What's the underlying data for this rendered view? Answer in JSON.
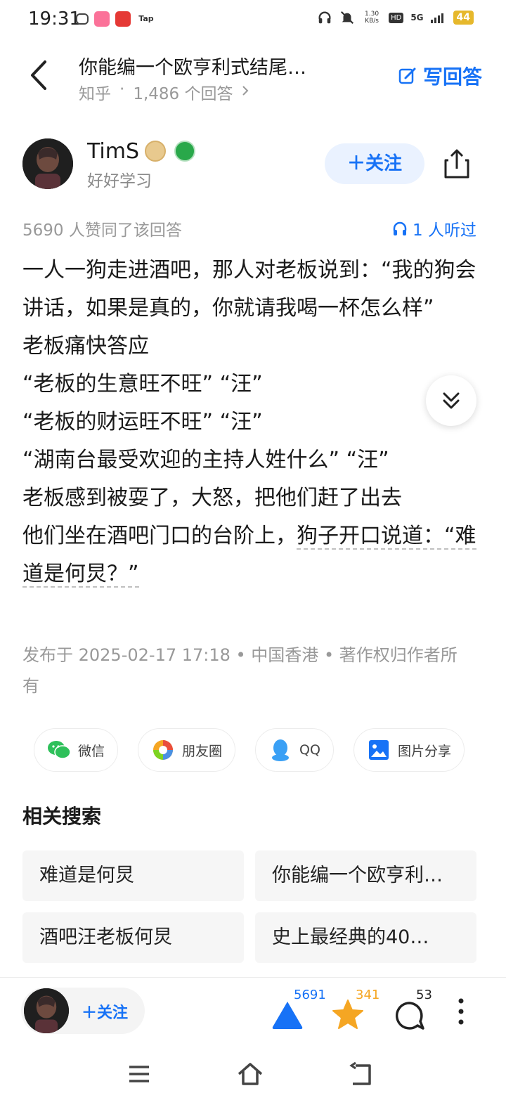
{
  "status_bar": {
    "time": "19:31",
    "net_speed_value": "1.30",
    "net_speed_unit": "KB/s",
    "hd": "HD",
    "network": "5G",
    "battery": "44",
    "app_icons": [
      "tv-app-icon",
      "bilibili-icon",
      "tv-icon",
      "tap-icon"
    ]
  },
  "header": {
    "title": "你能编一个欧亨利式结尾…",
    "source": "知乎",
    "dot": "·",
    "answer_count": "1,486 个回答",
    "write_label": "写回答"
  },
  "author": {
    "name": "TimS",
    "bio": "好好学习",
    "follow_label": "关注"
  },
  "stats": {
    "agree_text": "5690 人赞同了该回答",
    "listened_text": "1 人听过"
  },
  "content": {
    "paragraphs": [
      "一人一狗走进酒吧，那人对老板说到：“我的狗会讲话，如果是真的，你就请我喝一杯怎么样”",
      "老板痛快答应",
      "“老板的生意旺不旺” “汪”",
      "“老板的财运旺不旺” “汪”",
      "“湖南台最受欢迎的主持人姓什么” “汪”",
      "老板感到被耍了，大怒，把他们赶了出去"
    ],
    "last_lead": "他们坐在酒吧门口的台阶上，",
    "last_underlined": "狗子开口说道：“难道是何炅？”"
  },
  "publish_text": "发布于 2025-02-17 17:18 • 中国香港 • 著作权归作者所有",
  "share": {
    "wechat": "微信",
    "moments": "朋友圈",
    "qq": "QQ",
    "image_share": "图片分享"
  },
  "related": {
    "title": "相关搜索",
    "items": [
      "难道是何炅",
      "你能编一个欧亨利…",
      "酒吧汪老板何炅",
      "史上最经典的40…"
    ]
  },
  "bottom_bar": {
    "follow_label": "关注",
    "upvote_count": "5691",
    "favorite_count": "341",
    "comment_count": "53"
  },
  "colors": {
    "accent": "#1772f6",
    "favorite": "#f5a623",
    "muted": "#999999"
  }
}
